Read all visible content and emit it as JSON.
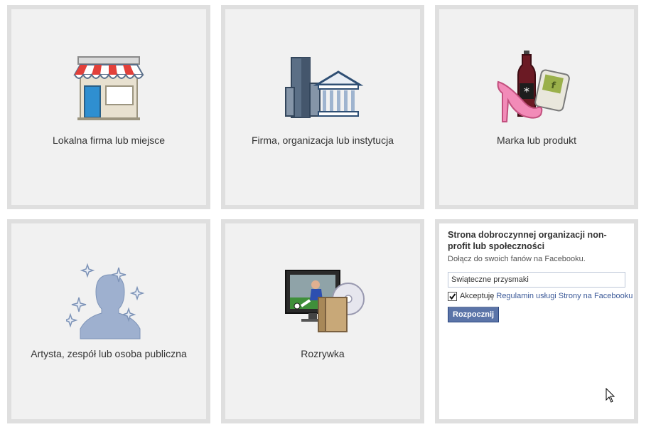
{
  "categories": [
    {
      "id": "local",
      "label": "Lokalna firma lub miejsce",
      "icon": "storefront-icon"
    },
    {
      "id": "company",
      "label": "Firma, organizacja lub instytucja",
      "icon": "buildings-icon"
    },
    {
      "id": "brand",
      "label": "Marka lub produkt",
      "icon": "products-icon"
    },
    {
      "id": "artist",
      "label": "Artysta, zespół lub osoba publiczna",
      "icon": "public-figure-icon"
    },
    {
      "id": "entertainment",
      "label": "Rozrywka",
      "icon": "entertainment-icon"
    }
  ],
  "form": {
    "title": "Strona dobroczynnej organizacji non-profit lub społeczności",
    "subtitle": "Dołącz do swoich fanów na Facebooku.",
    "name_value": "Świąteczne przysmaki",
    "accept_prefix": "Akceptuję ",
    "terms_link": "Regulamin usługi Strony na Facebooku",
    "accepted": true,
    "submit_label": "Rozpocznij"
  },
  "colors": {
    "tile_bg": "#f1f1f1",
    "tile_border": "#dfdfdf",
    "link": "#3b5998",
    "button": "#5b74a8"
  }
}
